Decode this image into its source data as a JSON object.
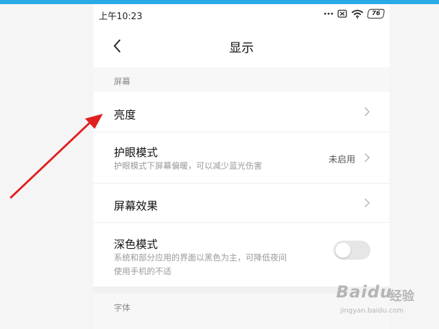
{
  "status_bar": {
    "time": "上午10:23",
    "battery": "76",
    "icons": [
      "dots-icon",
      "sim-off-icon",
      "wifi-icon",
      "battery-icon"
    ]
  },
  "header": {
    "title": "显示",
    "back_icon": "chevron-left-icon"
  },
  "sections": [
    {
      "label": "屏幕",
      "items": [
        {
          "title": "亮度",
          "subtitle": "",
          "value": "",
          "control": "chevron"
        },
        {
          "title": "护眼模式",
          "subtitle": "护眼模式下屏幕偏暖，可以减少蓝光伤害",
          "value": "未启用",
          "control": "chevron"
        },
        {
          "title": "屏幕效果",
          "subtitle": "",
          "value": "",
          "control": "chevron"
        },
        {
          "title": "深色模式",
          "subtitle_lines": [
            "系统和部分应用的界面以黑色为主，可降低夜间",
            "使用手机的不适"
          ],
          "value": "",
          "control": "toggle",
          "toggle_on": false
        }
      ]
    },
    {
      "label": "字体",
      "items": []
    }
  ],
  "watermark": {
    "brand": "Baidu",
    "brand_cn": "经验",
    "url": "jingyan.baidu.com"
  },
  "colors": {
    "accent_strip": "#29a9e6",
    "annotation_arrow": "#e02020"
  }
}
